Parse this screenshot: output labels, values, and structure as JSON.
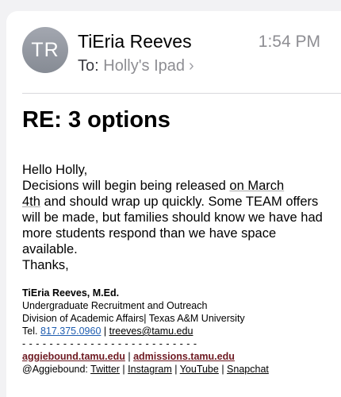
{
  "sender": {
    "initials": "TR",
    "name": "TiEria Reeves",
    "time": "1:54 PM",
    "to_label": "To:",
    "to_value": "Holly's Ipad"
  },
  "subject": "RE: 3 options",
  "body": {
    "greeting": "Hello Holly,",
    "line1_a": "Decisions will begin being released ",
    "line1_b": "on March",
    "line2_a": "4th",
    "line2_b": " and should wrap up quickly. Some TEAM offers will be made, but families should know we have had more students respond than we have space available.",
    "closing": "Thanks,"
  },
  "signature": {
    "name": "TiEria Reeves, M.Ed.",
    "dept": "Undergraduate Recruitment and Outreach",
    "division": "Division of Academic Affairs| Texas A&M University",
    "tel_label": "Tel. ",
    "phone": "817.375.0960",
    "sep": " | ",
    "email": "treeves@tamu.edu",
    "dashes": "- - - - - - - - - - - - - - - - - - - - - - - - - -",
    "link1": "aggiebound.tamu.edu",
    "link_sep": " | ",
    "link2": "admissions.tamu.edu",
    "social_prefix": "@Aggiebound: ",
    "twitter": "Twitter",
    "instagram": "Instagram",
    "youtube": "YouTube",
    "snapchat": "Snapchat"
  }
}
